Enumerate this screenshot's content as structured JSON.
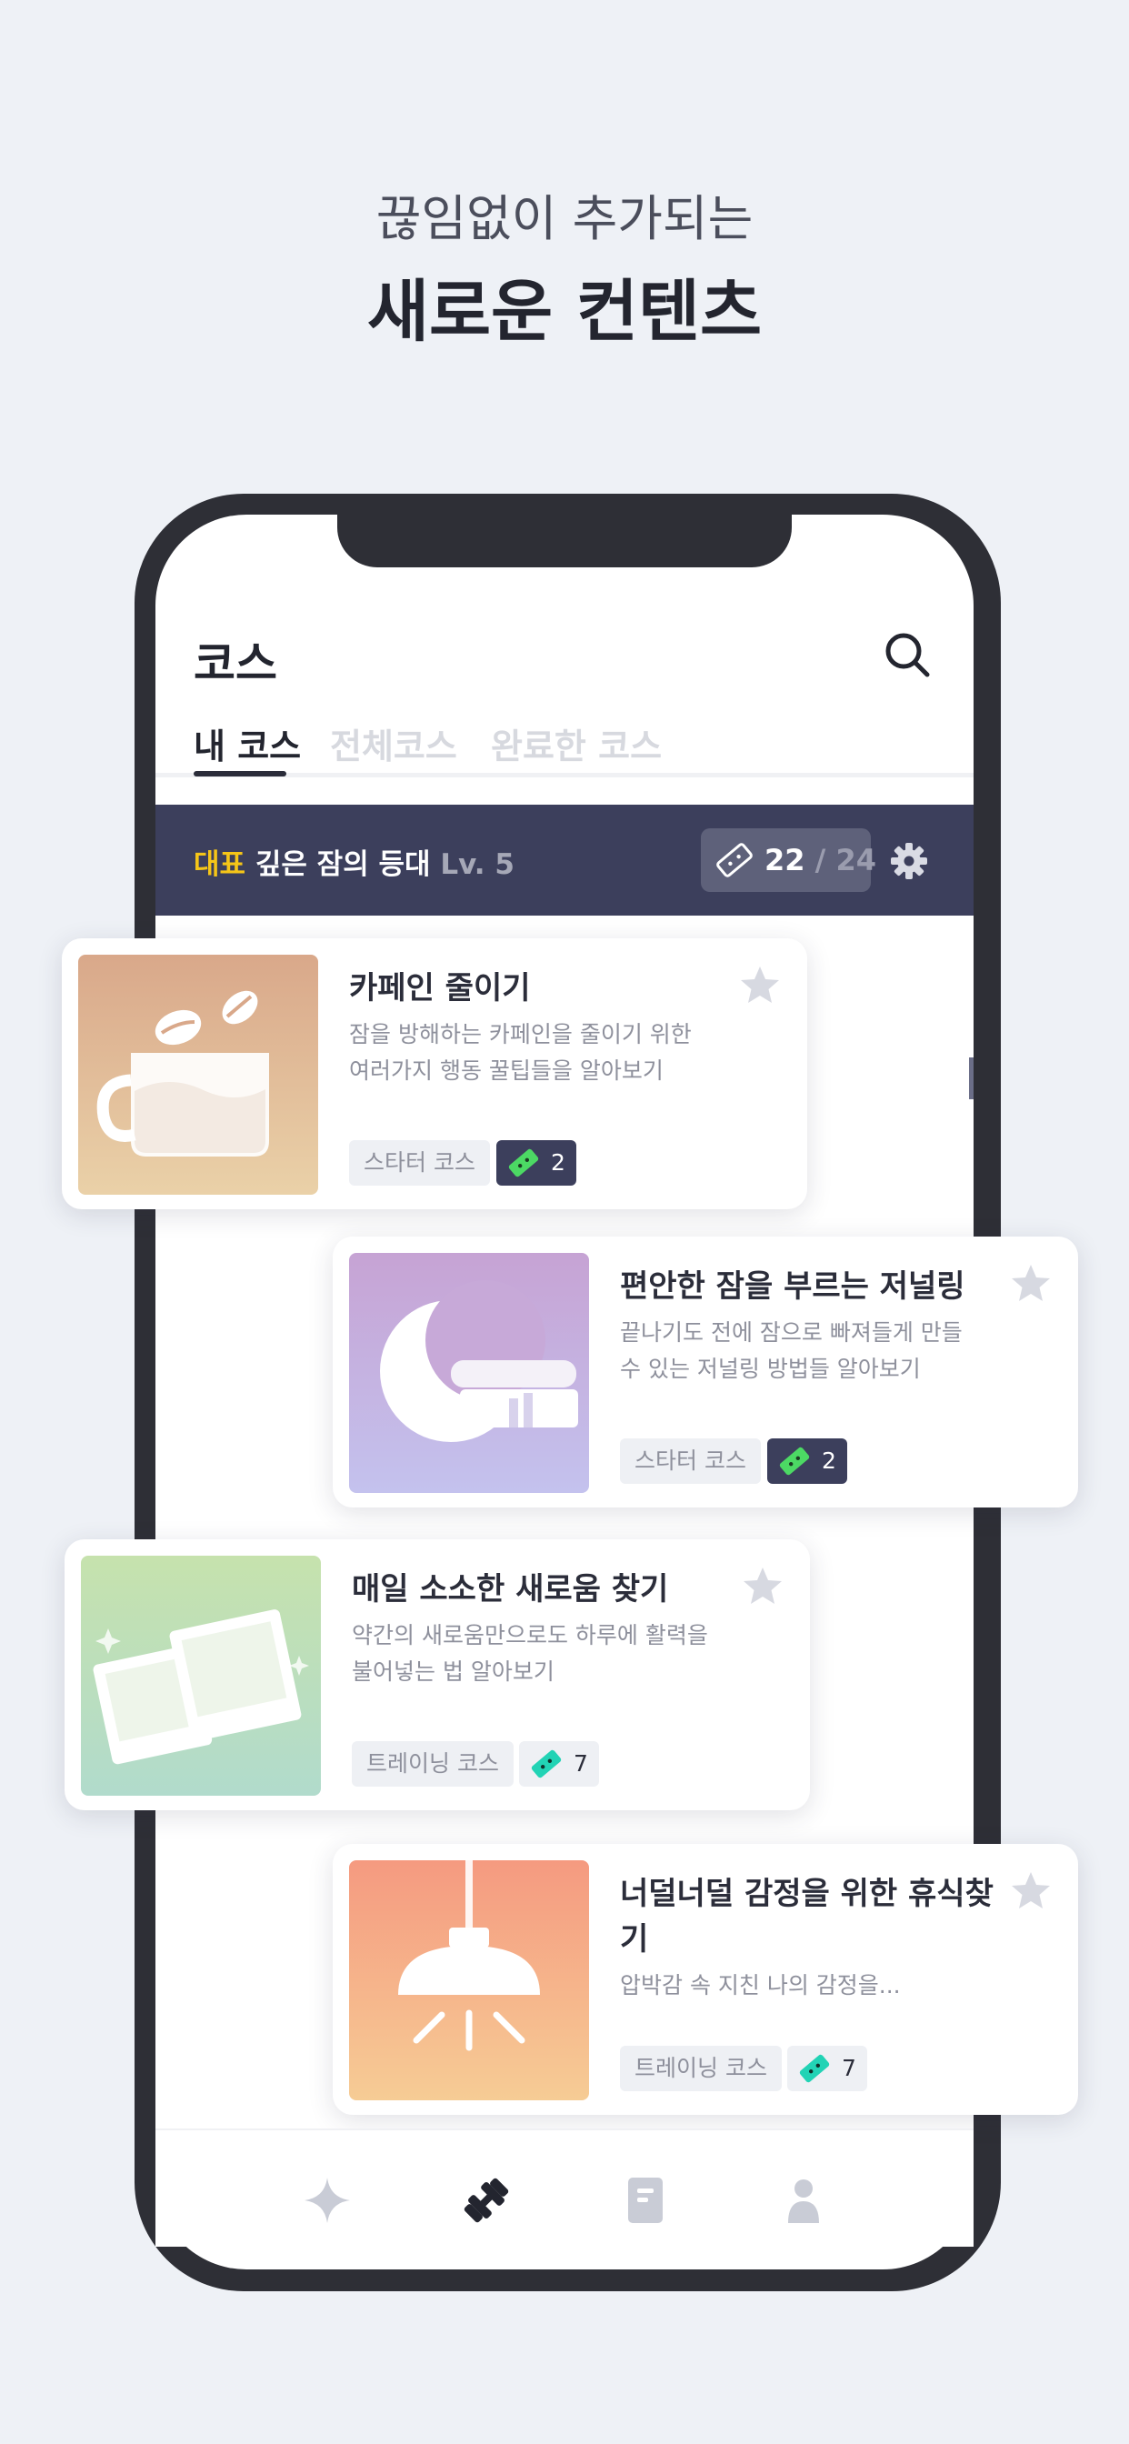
{
  "headline": {
    "sub": "끊임없이 추가되는",
    "main": "새로운 컨텐츠"
  },
  "app": {
    "title": "코스",
    "tabs": [
      {
        "label": "내 코스",
        "active": true
      },
      {
        "label": "전체코스",
        "active": false
      },
      {
        "label": "완료한 코스",
        "active": false
      }
    ]
  },
  "banner": {
    "tag": "대표",
    "name": "깊은 잠의 등대",
    "level": "Lv. 5",
    "tickets_have": "22",
    "tickets_total": "/ 24"
  },
  "courses": [
    {
      "title": "카페인 줄이기",
      "desc": "잠을 방해하는 카페인을 줄이기 위한 여러가지 행동 꿀팁들을 알아보기",
      "type": "스타터 코스",
      "tickets": "2",
      "thumb_icon": "coffee-cup-icon"
    },
    {
      "title": "편안한 잠을 부르는 저널링",
      "desc": "끝나기도 전에 잠으로 빠져들게 만들 수 있는 저널링 방법들 알아보기",
      "type": "스타터 코스",
      "tickets": "2",
      "thumb_icon": "moon-book-icon"
    },
    {
      "title": "매일 소소한 새로움 찾기",
      "desc": "약간의 새로움만으로도 하루에 활력을 불어넣는 법 알아보기",
      "type": "트레이닝 코스",
      "tickets": "7",
      "thumb_icon": "photos-icon"
    },
    {
      "title": "너덜너덜 감정을 위한 휴식찾기",
      "desc": "압박감 속 지친 나의 감정을...",
      "type": "트레이닝 코스",
      "tickets": "7",
      "thumb_icon": "lamp-icon"
    }
  ],
  "colors": {
    "background": "#eef1f6",
    "banner": "#3c3f5c",
    "accent_yellow": "#f5c518",
    "ticket_green": "#4cd964",
    "ticket_teal": "#22d3b5"
  },
  "bottom_nav": [
    {
      "icon": "sparkle-icon",
      "active": false
    },
    {
      "icon": "dumbbell-icon",
      "active": true
    },
    {
      "icon": "notebook-icon",
      "active": false
    },
    {
      "icon": "profile-icon",
      "active": false
    }
  ]
}
